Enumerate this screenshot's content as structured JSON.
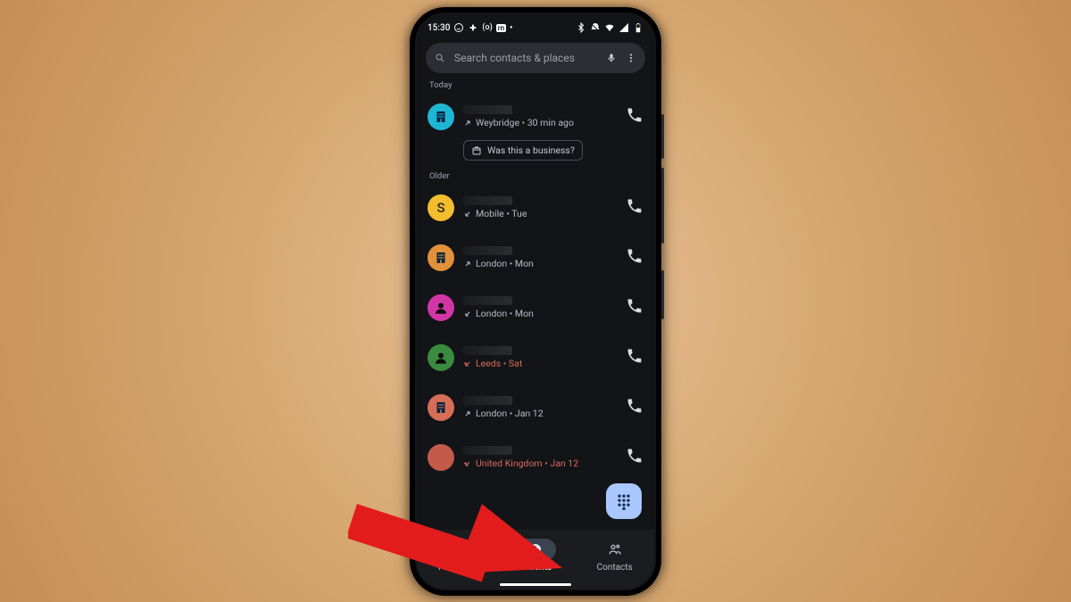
{
  "status": {
    "time": "15:30",
    "apps": [
      "whatsapp",
      "slack",
      "(o)",
      "rn"
    ]
  },
  "search": {
    "placeholder": "Search contacts & places"
  },
  "sections": {
    "today": "Today",
    "older": "Older"
  },
  "chip": "Was this a business?",
  "calls": [
    {
      "avatar_kind": "building",
      "avatar_color": "#1fb6d4",
      "dir": "out",
      "missed": false,
      "sub": "Weybridge • 30 min ago",
      "chip": true
    },
    {
      "avatar_kind": "letter",
      "avatar_letter": "S",
      "avatar_color": "#f3bd2d",
      "dir": "in",
      "missed": false,
      "sub": "Mobile • Tue"
    },
    {
      "avatar_kind": "building",
      "avatar_color": "#e2903a",
      "dir": "out",
      "missed": false,
      "sub": "London • Mon"
    },
    {
      "avatar_kind": "person",
      "avatar_color": "#d136a6",
      "dir": "in",
      "missed": false,
      "sub": "London • Mon"
    },
    {
      "avatar_kind": "person",
      "avatar_color": "#3a8a3f",
      "dir": "missed",
      "missed": true,
      "sub": "Leeds • Sat"
    },
    {
      "avatar_kind": "building",
      "avatar_color": "#d66e55",
      "dir": "out",
      "missed": false,
      "sub": "London • Jan 12"
    },
    {
      "avatar_kind": "letter",
      "avatar_letter": "",
      "avatar_color": "#c35a4a",
      "dir": "missed",
      "missed": true,
      "sub": "United Kingdom • Jan 12"
    }
  ],
  "tabs": {
    "favorites": "Favorites",
    "recents": "Recents",
    "contacts": "Contacts"
  }
}
